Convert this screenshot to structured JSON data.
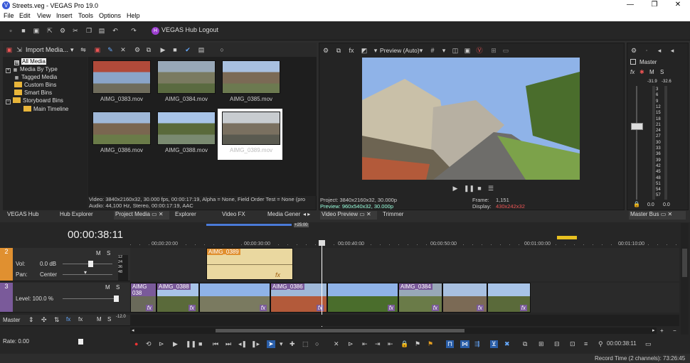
{
  "window": {
    "title": "Streets.veg - VEGAS Pro 19.0",
    "min": "—",
    "max": "❐",
    "close": "✕"
  },
  "menu": [
    "File",
    "Edit",
    "View",
    "Insert",
    "Tools",
    "Options",
    "Help"
  ],
  "hub": {
    "badge": "H",
    "label": "VEGAS Hub Logout"
  },
  "media_toolbar": {
    "import_label": "Import Media..."
  },
  "tree": [
    {
      "label": "All Media",
      "selected": true
    },
    {
      "label": "Media By Type"
    },
    {
      "label": "Tagged Media"
    },
    {
      "label": "Custom Bins"
    },
    {
      "label": "Smart Bins"
    },
    {
      "label": "Storyboard Bins"
    },
    {
      "label": "Main Timeline"
    }
  ],
  "media_items": [
    {
      "name": "AIMG_0383.mov",
      "colors": [
        "#b04a3a",
        "#8aa4c8",
        "#6f6c5c"
      ]
    },
    {
      "name": "AIMG_0384.mov",
      "colors": [
        "#98a8b8",
        "#7a7a60",
        "#5a6a40"
      ]
    },
    {
      "name": "AIMG_0385.mov",
      "colors": [
        "#a8c0e0",
        "#7b6a55",
        "#6c7a50"
      ]
    },
    {
      "name": "AIMG_0386.mov",
      "colors": [
        "#9fb8d8",
        "#7a6650",
        "#6a7b48"
      ]
    },
    {
      "name": "AIMG_0388.mov",
      "colors": [
        "#a8c4e8",
        "#5a6a3a",
        "#7a8a70"
      ]
    },
    {
      "name": "AIMG_0389.mov",
      "colors": [
        "#c8ccd0",
        "#7a7060",
        "#5a5a50"
      ],
      "selected": true
    }
  ],
  "media_info": {
    "line1": "Video: 3840x2160x32, 30.000 fps, 00:00:17:19, Alpha = None, Field Order Test = None (pro",
    "line2": "Audio: 44,100 Hz, Stereo, 00:00:17:19, AAC"
  },
  "preview": {
    "mode": "Preview (Auto)",
    "project": "Project:  3840x2160x32, 30.000p",
    "preview_line": "Preview: 960x540x32, 30.000p",
    "frame_label": "Frame:",
    "frame_value": "1,151",
    "display_label": "Display:",
    "display_value": "430x242x32"
  },
  "master": {
    "title": "Master",
    "m": "M",
    "s": "S",
    "peak_l": "-31.9",
    "peak_r": "-32.6",
    "scale": [
      "3",
      "6",
      "9",
      "12",
      "15",
      "18",
      "21",
      "24",
      "27",
      "30",
      "33",
      "36",
      "39",
      "42",
      "45",
      "48",
      "51",
      "54",
      "57"
    ],
    "bottom_l": "0.0",
    "bottom_r": "0.0"
  },
  "tabs": {
    "left": [
      "VEGAS Hub",
      "Hub Explorer",
      "Project Media",
      "Explorer",
      "Video FX",
      "Media Gener"
    ],
    "preview": [
      "Video Preview",
      "Trimmer"
    ],
    "master": "Master Bus"
  },
  "timeline": {
    "time": "00:00:38:11",
    "ruler": [
      "00:00:20:00",
      "00:00:30:00",
      "00:00:40:00",
      "00:00:50:00",
      "00:01:00:00",
      "00:01:10:00"
    ],
    "cursor_marker": "+25:00",
    "tracks": [
      {
        "num": "2",
        "vol_label": "Vol:",
        "vol_value": "0.0 dB",
        "pan_label": "Pan:",
        "pan_value": "Center",
        "m": "M",
        "s": "S",
        "meter": [
          "12",
          "24",
          "36",
          "48"
        ]
      },
      {
        "num": "3",
        "level_label": "Level: 100.0 %",
        "m": "M",
        "s": "S"
      }
    ],
    "audio_clip": "AIMG_0389",
    "video_clips": [
      "AIMG 038",
      "AIMG_0388",
      "AIMG_0386",
      "AIMG_0384"
    ],
    "master_label": "Master",
    "master_m": "M",
    "master_s": "S",
    "master_db": "-12.0",
    "rate": "Rate: 0.00",
    "fx": "fx"
  },
  "transport_time": "00:00:38:11",
  "status": "Record Time (2 channels): 73:26:45"
}
